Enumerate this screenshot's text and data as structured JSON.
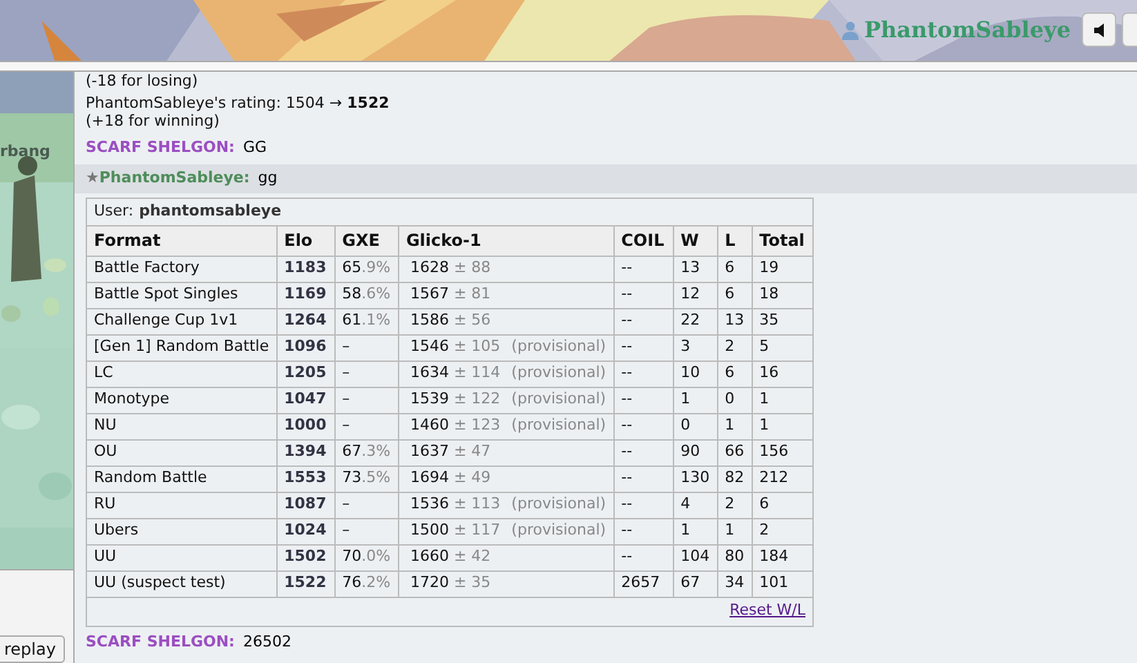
{
  "header": {
    "username": "PhantomSableye"
  },
  "left_panel": {
    "partial_name": "rbang",
    "replay_button": "replay"
  },
  "chat": {
    "lines": [
      {
        "kind": "note",
        "text": "(-18 for losing)"
      },
      {
        "kind": "note",
        "text": "PhantomSableye's rating: 1504 → **1522**"
      },
      {
        "kind": "note",
        "text": "(+18 for winning)"
      },
      {
        "kind": "message",
        "user": "SCARF SHELGON:",
        "message": "GG",
        "color": "#9b4fc1",
        "highlighted": false
      },
      {
        "kind": "message",
        "rank": "★",
        "user": "PhantomSableye:",
        "message": "gg",
        "color": "#4e8d5a",
        "highlighted": true
      }
    ]
  },
  "ladder": {
    "user_label": "User:",
    "user": "phantomsableye",
    "columns": [
      "Format",
      "Elo",
      "GXE",
      "Glicko-1",
      "COIL",
      "W",
      "L",
      "Total"
    ],
    "rows": [
      {
        "format": "Battle Factory",
        "elo": "1183",
        "gxe": "65",
        "gxe_decimal": ".9%",
        "glicko": "1628",
        "deviation": "± 88",
        "coil": "--",
        "w": "13",
        "l": "6",
        "total": "19"
      },
      {
        "format": "Battle Spot Singles",
        "elo": "1169",
        "gxe": "58",
        "gxe_decimal": ".6%",
        "glicko": "1567",
        "deviation": "± 81",
        "coil": "--",
        "w": "12",
        "l": "6",
        "total": "18"
      },
      {
        "format": "Challenge Cup 1v1",
        "elo": "1264",
        "gxe": "61",
        "gxe_decimal": ".1%",
        "glicko": "1586",
        "deviation": "± 56",
        "coil": "--",
        "w": "22",
        "l": "13",
        "total": "35"
      },
      {
        "format": "[Gen 1] Random Battle",
        "elo": "1096",
        "gxe": "–",
        "glicko": "1546",
        "deviation": "± 105",
        "provisional": "(provisional)",
        "coil": "--",
        "w": "3",
        "l": "2",
        "total": "5"
      },
      {
        "format": "LC",
        "elo": "1205",
        "gxe": "–",
        "glicko": "1634",
        "deviation": "± 114",
        "provisional": "(provisional)",
        "coil": "--",
        "w": "10",
        "l": "6",
        "total": "16"
      },
      {
        "format": "Monotype",
        "elo": "1047",
        "gxe": "–",
        "glicko": "1539",
        "deviation": "± 122",
        "provisional": "(provisional)",
        "coil": "--",
        "w": "1",
        "l": "0",
        "total": "1"
      },
      {
        "format": "NU",
        "elo": "1000",
        "gxe": "–",
        "glicko": "1460",
        "deviation": "± 123",
        "provisional": "(provisional)",
        "coil": "--",
        "w": "0",
        "l": "1",
        "total": "1"
      },
      {
        "format": "OU",
        "elo": "1394",
        "gxe": "67",
        "gxe_decimal": ".3%",
        "glicko": "1637",
        "deviation": "± 47",
        "coil": "--",
        "w": "90",
        "l": "66",
        "total": "156"
      },
      {
        "format": "Random Battle",
        "elo": "1553",
        "gxe": "73",
        "gxe_decimal": ".5%",
        "glicko": "1694",
        "deviation": "± 49",
        "coil": "--",
        "w": "130",
        "l": "82",
        "total": "212"
      },
      {
        "format": "RU",
        "elo": "1087",
        "gxe": "–",
        "glicko": "1536",
        "deviation": "± 113",
        "provisional": "(provisional)",
        "coil": "--",
        "w": "4",
        "l": "2",
        "total": "6"
      },
      {
        "format": "Ubers",
        "elo": "1024",
        "gxe": "–",
        "glicko": "1500",
        "deviation": "± 117",
        "provisional": "(provisional)",
        "coil": "--",
        "w": "1",
        "l": "1",
        "total": "2"
      },
      {
        "format": "UU",
        "elo": "1502",
        "gxe": "70",
        "gxe_decimal": ".0%",
        "glicko": "1660",
        "deviation": "± 42",
        "coil": "--",
        "w": "104",
        "l": "80",
        "total": "184"
      },
      {
        "format": "UU (suspect test)",
        "elo": "1522",
        "gxe": "76",
        "gxe_decimal": ".2%",
        "glicko": "1720",
        "deviation": "± 35",
        "coil": "2657",
        "w": "67",
        "l": "34",
        "total": "101"
      }
    ],
    "reset_link": "Reset W/L"
  },
  "last_message": {
    "user": "SCARF SHELGON:",
    "message": "26502",
    "color": "#9b4fc1"
  }
}
